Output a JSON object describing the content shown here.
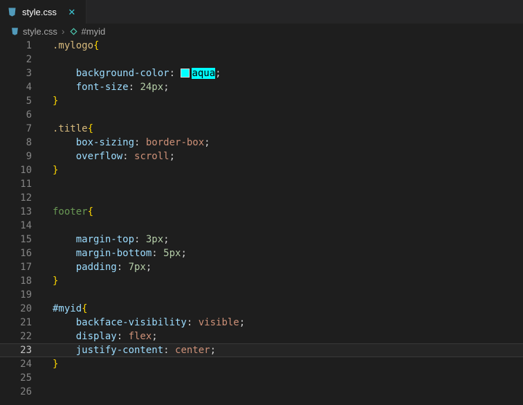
{
  "tab": {
    "label": "style.css",
    "close_glyph": "✕"
  },
  "breadcrumb": {
    "file": "style.css",
    "separator": "›",
    "symbol": "#myid"
  },
  "editor": {
    "active_line": 23,
    "lines": [
      {
        "num": 1,
        "tokens": [
          {
            "t": ".mylogo",
            "c": "sel-class"
          },
          {
            "t": "{",
            "c": "brace"
          }
        ]
      },
      {
        "num": 2,
        "tokens": []
      },
      {
        "num": 3,
        "tokens": [
          {
            "t": "    background-color",
            "c": "prop"
          },
          {
            "t": ": ",
            "c": "punct"
          },
          {
            "swatch": true
          },
          {
            "t": "aqua",
            "c": "aqua"
          },
          {
            "t": ";",
            "c": "punct"
          }
        ]
      },
      {
        "num": 4,
        "tokens": [
          {
            "t": "    font-size",
            "c": "prop"
          },
          {
            "t": ": ",
            "c": "punct"
          },
          {
            "t": "24px",
            "c": "num"
          },
          {
            "t": ";",
            "c": "punct"
          }
        ]
      },
      {
        "num": 5,
        "tokens": [
          {
            "t": "}",
            "c": "brace"
          }
        ]
      },
      {
        "num": 6,
        "tokens": []
      },
      {
        "num": 7,
        "tokens": [
          {
            "t": ".title",
            "c": "sel-class"
          },
          {
            "t": "{",
            "c": "brace"
          }
        ]
      },
      {
        "num": 8,
        "tokens": [
          {
            "t": "    box-sizing",
            "c": "prop"
          },
          {
            "t": ": ",
            "c": "punct"
          },
          {
            "t": "border-box",
            "c": "value"
          },
          {
            "t": ";",
            "c": "punct"
          }
        ]
      },
      {
        "num": 9,
        "tokens": [
          {
            "t": "    overflow",
            "c": "prop"
          },
          {
            "t": ": ",
            "c": "punct"
          },
          {
            "t": "scroll",
            "c": "value"
          },
          {
            "t": ";",
            "c": "punct"
          }
        ]
      },
      {
        "num": 10,
        "tokens": [
          {
            "t": "}",
            "c": "brace"
          }
        ]
      },
      {
        "num": 11,
        "tokens": []
      },
      {
        "num": 12,
        "tokens": []
      },
      {
        "num": 13,
        "tokens": [
          {
            "t": "footer",
            "c": "sel-tag"
          },
          {
            "t": "{",
            "c": "brace"
          }
        ]
      },
      {
        "num": 14,
        "tokens": []
      },
      {
        "num": 15,
        "tokens": [
          {
            "t": "    margin-top",
            "c": "prop"
          },
          {
            "t": ": ",
            "c": "punct"
          },
          {
            "t": "3px",
            "c": "num"
          },
          {
            "t": ";",
            "c": "punct"
          }
        ]
      },
      {
        "num": 16,
        "tokens": [
          {
            "t": "    margin-bottom",
            "c": "prop"
          },
          {
            "t": ": ",
            "c": "punct"
          },
          {
            "t": "5px",
            "c": "num"
          },
          {
            "t": ";",
            "c": "punct"
          }
        ]
      },
      {
        "num": 17,
        "tokens": [
          {
            "t": "    padding",
            "c": "prop"
          },
          {
            "t": ": ",
            "c": "punct"
          },
          {
            "t": "7px",
            "c": "num"
          },
          {
            "t": ";",
            "c": "punct"
          }
        ]
      },
      {
        "num": 18,
        "tokens": [
          {
            "t": "}",
            "c": "brace"
          }
        ]
      },
      {
        "num": 19,
        "tokens": []
      },
      {
        "num": 20,
        "tokens": [
          {
            "t": "#myid",
            "c": "sel-id"
          },
          {
            "t": "{",
            "c": "brace"
          }
        ]
      },
      {
        "num": 21,
        "tokens": [
          {
            "t": "    backface-visibility",
            "c": "prop"
          },
          {
            "t": ": ",
            "c": "punct"
          },
          {
            "t": "visible",
            "c": "value"
          },
          {
            "t": ";",
            "c": "punct"
          }
        ]
      },
      {
        "num": 22,
        "tokens": [
          {
            "t": "    display",
            "c": "prop"
          },
          {
            "t": ": ",
            "c": "punct"
          },
          {
            "t": "flex",
            "c": "value"
          },
          {
            "t": ";",
            "c": "punct"
          }
        ]
      },
      {
        "num": 23,
        "tokens": [
          {
            "t": "    justify-content",
            "c": "prop"
          },
          {
            "t": ": ",
            "c": "punct"
          },
          {
            "t": "center",
            "c": "value"
          },
          {
            "t": ";",
            "c": "punct"
          }
        ]
      },
      {
        "num": 24,
        "tokens": [
          {
            "t": "}",
            "c": "brace"
          }
        ]
      },
      {
        "num": 25,
        "tokens": []
      },
      {
        "num": 26,
        "tokens": []
      }
    ]
  },
  "colors": {
    "editor_background": "#1e1e1e",
    "tabbar_background": "#252526",
    "selector_class": "#d7ba7d",
    "selector_tag": "#6a9955",
    "selector_id": "#9cdcfe",
    "brace": "#ffd700",
    "property": "#9cdcfe",
    "punctuation": "#d4d4d4",
    "value_keyword": "#ce9178",
    "number": "#b5cea8",
    "aqua_swatch": "#00ffff",
    "close_icon": "#3dc9d6",
    "file_icon": "#519aba",
    "symbol_icon": "#4ec9b0",
    "line_number": "#858585",
    "active_line_number": "#c6c6c6"
  }
}
